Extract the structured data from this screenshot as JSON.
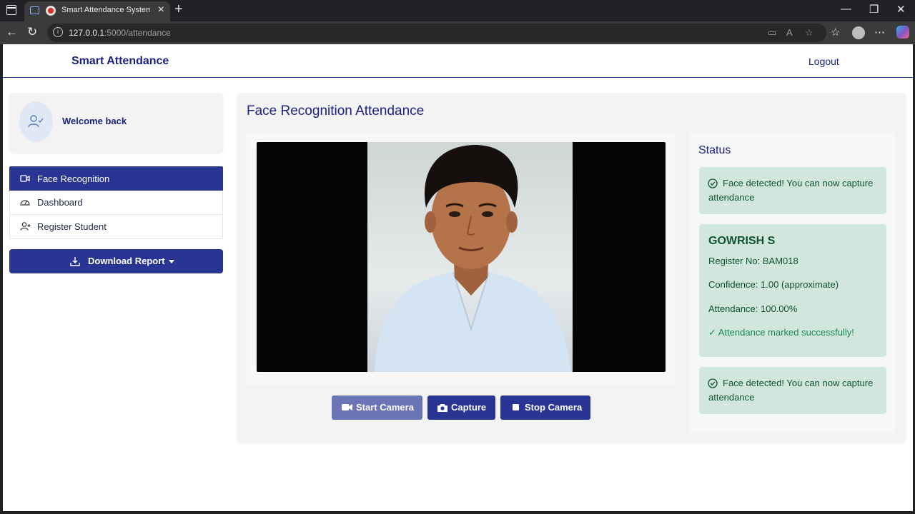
{
  "browser": {
    "tab_title": "Smart Attendance System - I",
    "url_host": "127.0.0.1",
    "url_path": ":5000/attendance"
  },
  "header": {
    "brand": "Smart Attendance",
    "logout_label": "Logout"
  },
  "sidebar": {
    "welcome": "Welcome back",
    "items": [
      {
        "label": "Face Recognition",
        "icon": "video-icon",
        "active": true
      },
      {
        "label": "Dashboard",
        "icon": "speedometer-icon",
        "active": false
      },
      {
        "label": "Register Student",
        "icon": "person-add-icon",
        "active": false
      }
    ],
    "download_label": "Download Report"
  },
  "main": {
    "title": "Face Recognition Attendance",
    "controls": {
      "start_label": "Start Camera",
      "capture_label": "Capture",
      "stop_label": "Stop Camera"
    }
  },
  "status": {
    "title": "Status",
    "alert_top": "Face detected! You can now capture attendance",
    "result": {
      "name": "GOWRISH S",
      "register": "Register No: BAM018",
      "confidence": "Confidence: 1.00 (approximate)",
      "attendance": "Attendance: 100.00%",
      "success": "✓ Attendance marked successfully!"
    },
    "alert_bottom": "Face detected! You can now capture attendance"
  },
  "colors": {
    "primary": "#283593",
    "brand_text": "#1a237e",
    "success_bg": "#d1e7dd",
    "success_text": "#0f5132"
  }
}
